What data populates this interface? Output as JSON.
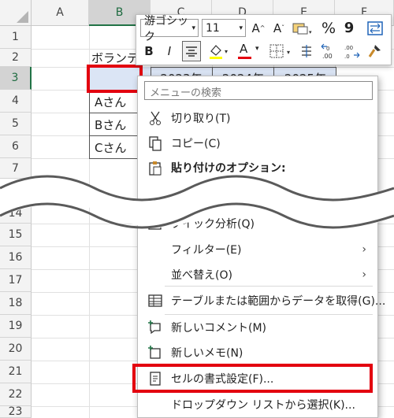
{
  "columns": [
    "A",
    "B",
    "C",
    "D",
    "E",
    "F"
  ],
  "rows_top": [
    "1",
    "2",
    "3",
    "4",
    "5",
    "6",
    "7"
  ],
  "rows_bottom": [
    "14",
    "15",
    "16",
    "17",
    "18",
    "19",
    "20",
    "21",
    "22",
    "23"
  ],
  "cells": {
    "b2": "ボランテ",
    "b4": "Aさん",
    "b5": "Bさん",
    "b6": "Cさん",
    "c3": "2023年",
    "d3": "2024年",
    "e3": "2025年"
  },
  "mini_toolbar": {
    "font_name": "游ゴシック",
    "font_size": "11",
    "grow_font": "A",
    "shrink_font": "A",
    "percent": "%",
    "comma": "9",
    "bold": "B",
    "italic": "I",
    "font_color_letter": "A",
    "inc_decimal": ".00",
    "dec_decimal": ".00",
    "accent_red": "#e3000f",
    "fill_yellow": "#ffff00"
  },
  "context_menu": {
    "search_placeholder": "メニューの検索",
    "items": [
      {
        "label": "切り取り(T)",
        "icon": "scissors-icon"
      },
      {
        "label": "コピー(C)",
        "icon": "copy-icon"
      },
      {
        "label": "貼り付けのオプション:",
        "icon": "paste-options-icon"
      },
      {
        "label": "クイック分析(Q)",
        "icon": "quick-analysis-icon"
      },
      {
        "label": "フィルター(E)",
        "icon": "",
        "submenu": true
      },
      {
        "label": "並べ替え(O)",
        "icon": "",
        "submenu": true
      },
      {
        "label": "テーブルまたは範囲からデータを取得(G)...",
        "icon": "table-icon"
      },
      {
        "label": "新しいコメント(M)",
        "icon": "new-comment-icon"
      },
      {
        "label": "新しいメモ(N)",
        "icon": "new-note-icon"
      },
      {
        "label": "セルの書式設定(F)...",
        "icon": "format-cells-icon"
      },
      {
        "label": "ドロップダウン リストから選択(K)...",
        "icon": ""
      }
    ]
  },
  "colors": {
    "highlight": "#e3000f",
    "selected_cell": "#dbe5f5",
    "header": "#f3f3f3",
    "excel_green": "#217346"
  }
}
